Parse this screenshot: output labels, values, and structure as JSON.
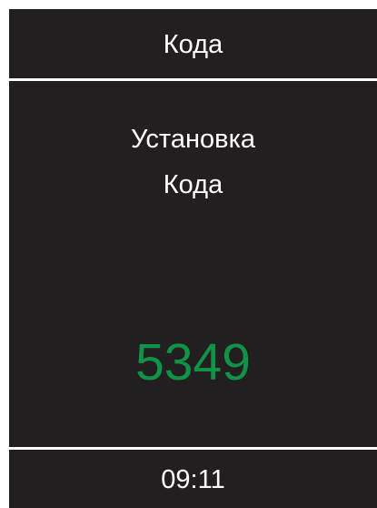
{
  "header": {
    "title": "Кода"
  },
  "message": {
    "line1": "Установка",
    "line2": "Кода"
  },
  "code": {
    "value": "5349",
    "color": "#0e9347"
  },
  "footer": {
    "time": "09:11"
  },
  "colors": {
    "background": "#231f20",
    "text": "#ffffff",
    "accent": "#0e9347"
  }
}
